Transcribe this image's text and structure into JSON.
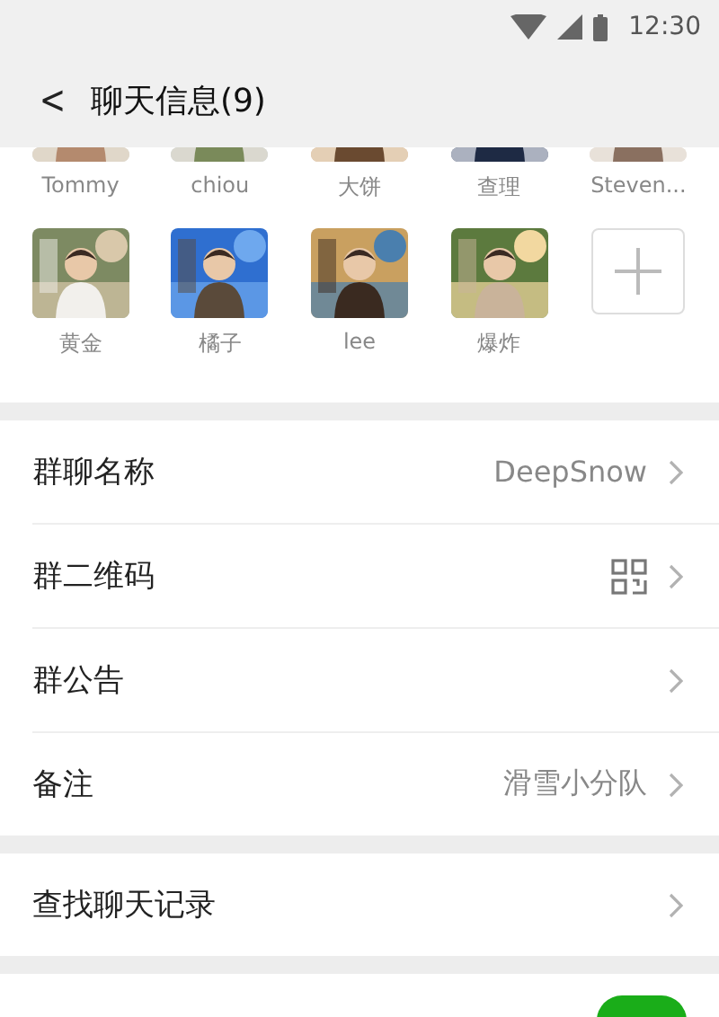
{
  "status_bar": {
    "time": "12:30"
  },
  "header": {
    "back": "<",
    "title": "聊天信息(9)"
  },
  "members": [
    {
      "name": "Tommy",
      "kind": "avatar",
      "partly_hidden": true
    },
    {
      "name": "chiou",
      "kind": "avatar",
      "partly_hidden": true
    },
    {
      "name": "大饼",
      "kind": "avatar",
      "partly_hidden": true
    },
    {
      "name": "查理",
      "kind": "avatar",
      "partly_hidden": true
    },
    {
      "name": "Steven...",
      "kind": "avatar",
      "partly_hidden": true
    },
    {
      "name": "黄金",
      "kind": "avatar",
      "partly_hidden": false
    },
    {
      "name": "橘子",
      "kind": "avatar",
      "partly_hidden": false
    },
    {
      "name": "lee",
      "kind": "avatar",
      "partly_hidden": false
    },
    {
      "name": "爆炸",
      "kind": "avatar",
      "partly_hidden": false
    },
    {
      "kind": "add"
    }
  ],
  "settings_groups": [
    [
      {
        "label": "群聊名称",
        "kind": "text",
        "value": "DeepSnow"
      },
      {
        "label": "群二维码",
        "kind": "qr"
      },
      {
        "label": "群公告",
        "kind": "plain"
      },
      {
        "label": "备注",
        "kind": "text",
        "value": "滑雪小分队"
      }
    ],
    [
      {
        "label": "查找聊天记录",
        "kind": "plain"
      }
    ]
  ],
  "partial_toggle": {
    "on": true
  }
}
